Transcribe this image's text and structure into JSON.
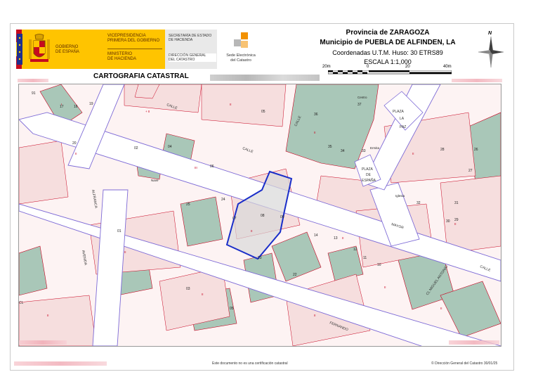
{
  "header": {
    "gov_line1": "GOBIERNO",
    "gov_line2": "DE ESPAÑA",
    "vice_line1": "VICEPRESIDENCIA",
    "vice_line2": "PRIMERA DEL GOBIERNO",
    "min_line1": "MINISTERIO",
    "min_line2": "DE HACIENDA",
    "sec_line1": "SECRETARÍA DE ESTADO",
    "sec_line2": "DE HACIENDA",
    "dir_line1": "DIRECCIÓN GENERAL",
    "dir_line2": "DEL CATASTRO",
    "sede_line1": "Sede Electrónica",
    "sede_line2": "del Catastro",
    "province": "Provincia de ZARAGOZA",
    "municipality": "Municipio de PUEBLA DE ALFINDEN, LA",
    "coords": "Coordenadas U.T.M. Huso: 30 ETRS89",
    "scale": "ESCALA 1:1,000",
    "scale_ticks": [
      "20m",
      "0",
      "20",
      "40m"
    ],
    "north": "N",
    "carto_title": "CARTOGRAFIA CATASTRAL"
  },
  "map": {
    "streets": [
      "CALLE",
      "CALLE",
      "CALLE",
      "MAYOR",
      "CALLE",
      "AVENIDA",
      "ALFRANCA",
      "FERNANDO",
      "CL MIGUEL ANTONIO",
      "PLAZA",
      "DE",
      "ESPAÑA",
      "PLAZA",
      "LA",
      "PAZ",
      "CL"
    ],
    "labels": [
      "91",
      "17",
      "16",
      "19",
      "20",
      "06",
      "35",
      "37",
      "36",
      "34",
      "33",
      "05",
      "07",
      "08",
      "09",
      "24",
      "25",
      "23",
      "01",
      "02",
      "03",
      "04",
      "32",
      "30",
      "31",
      "22",
      "14",
      "15",
      "13",
      "12",
      "11",
      "10",
      "27",
      "26",
      "28",
      "29",
      "Iglesia",
      "Centro",
      "Ermita",
      "Bloque",
      "Nave"
    ],
    "highlight_parcel": "08",
    "pool_label": "PISCINA"
  },
  "footer": {
    "notice": "Este documento no es una certificación catastral",
    "copyright": "© Dirección General del Catastro 30/01/25"
  },
  "colors": {
    "parcel_pink": "#f6dede",
    "parcel_green": "#a9c7b8",
    "parcel_line": "#c8001e",
    "street_line": "#7d6ad6",
    "highlight": "#1a2ec9",
    "ruler": "#000000"
  }
}
